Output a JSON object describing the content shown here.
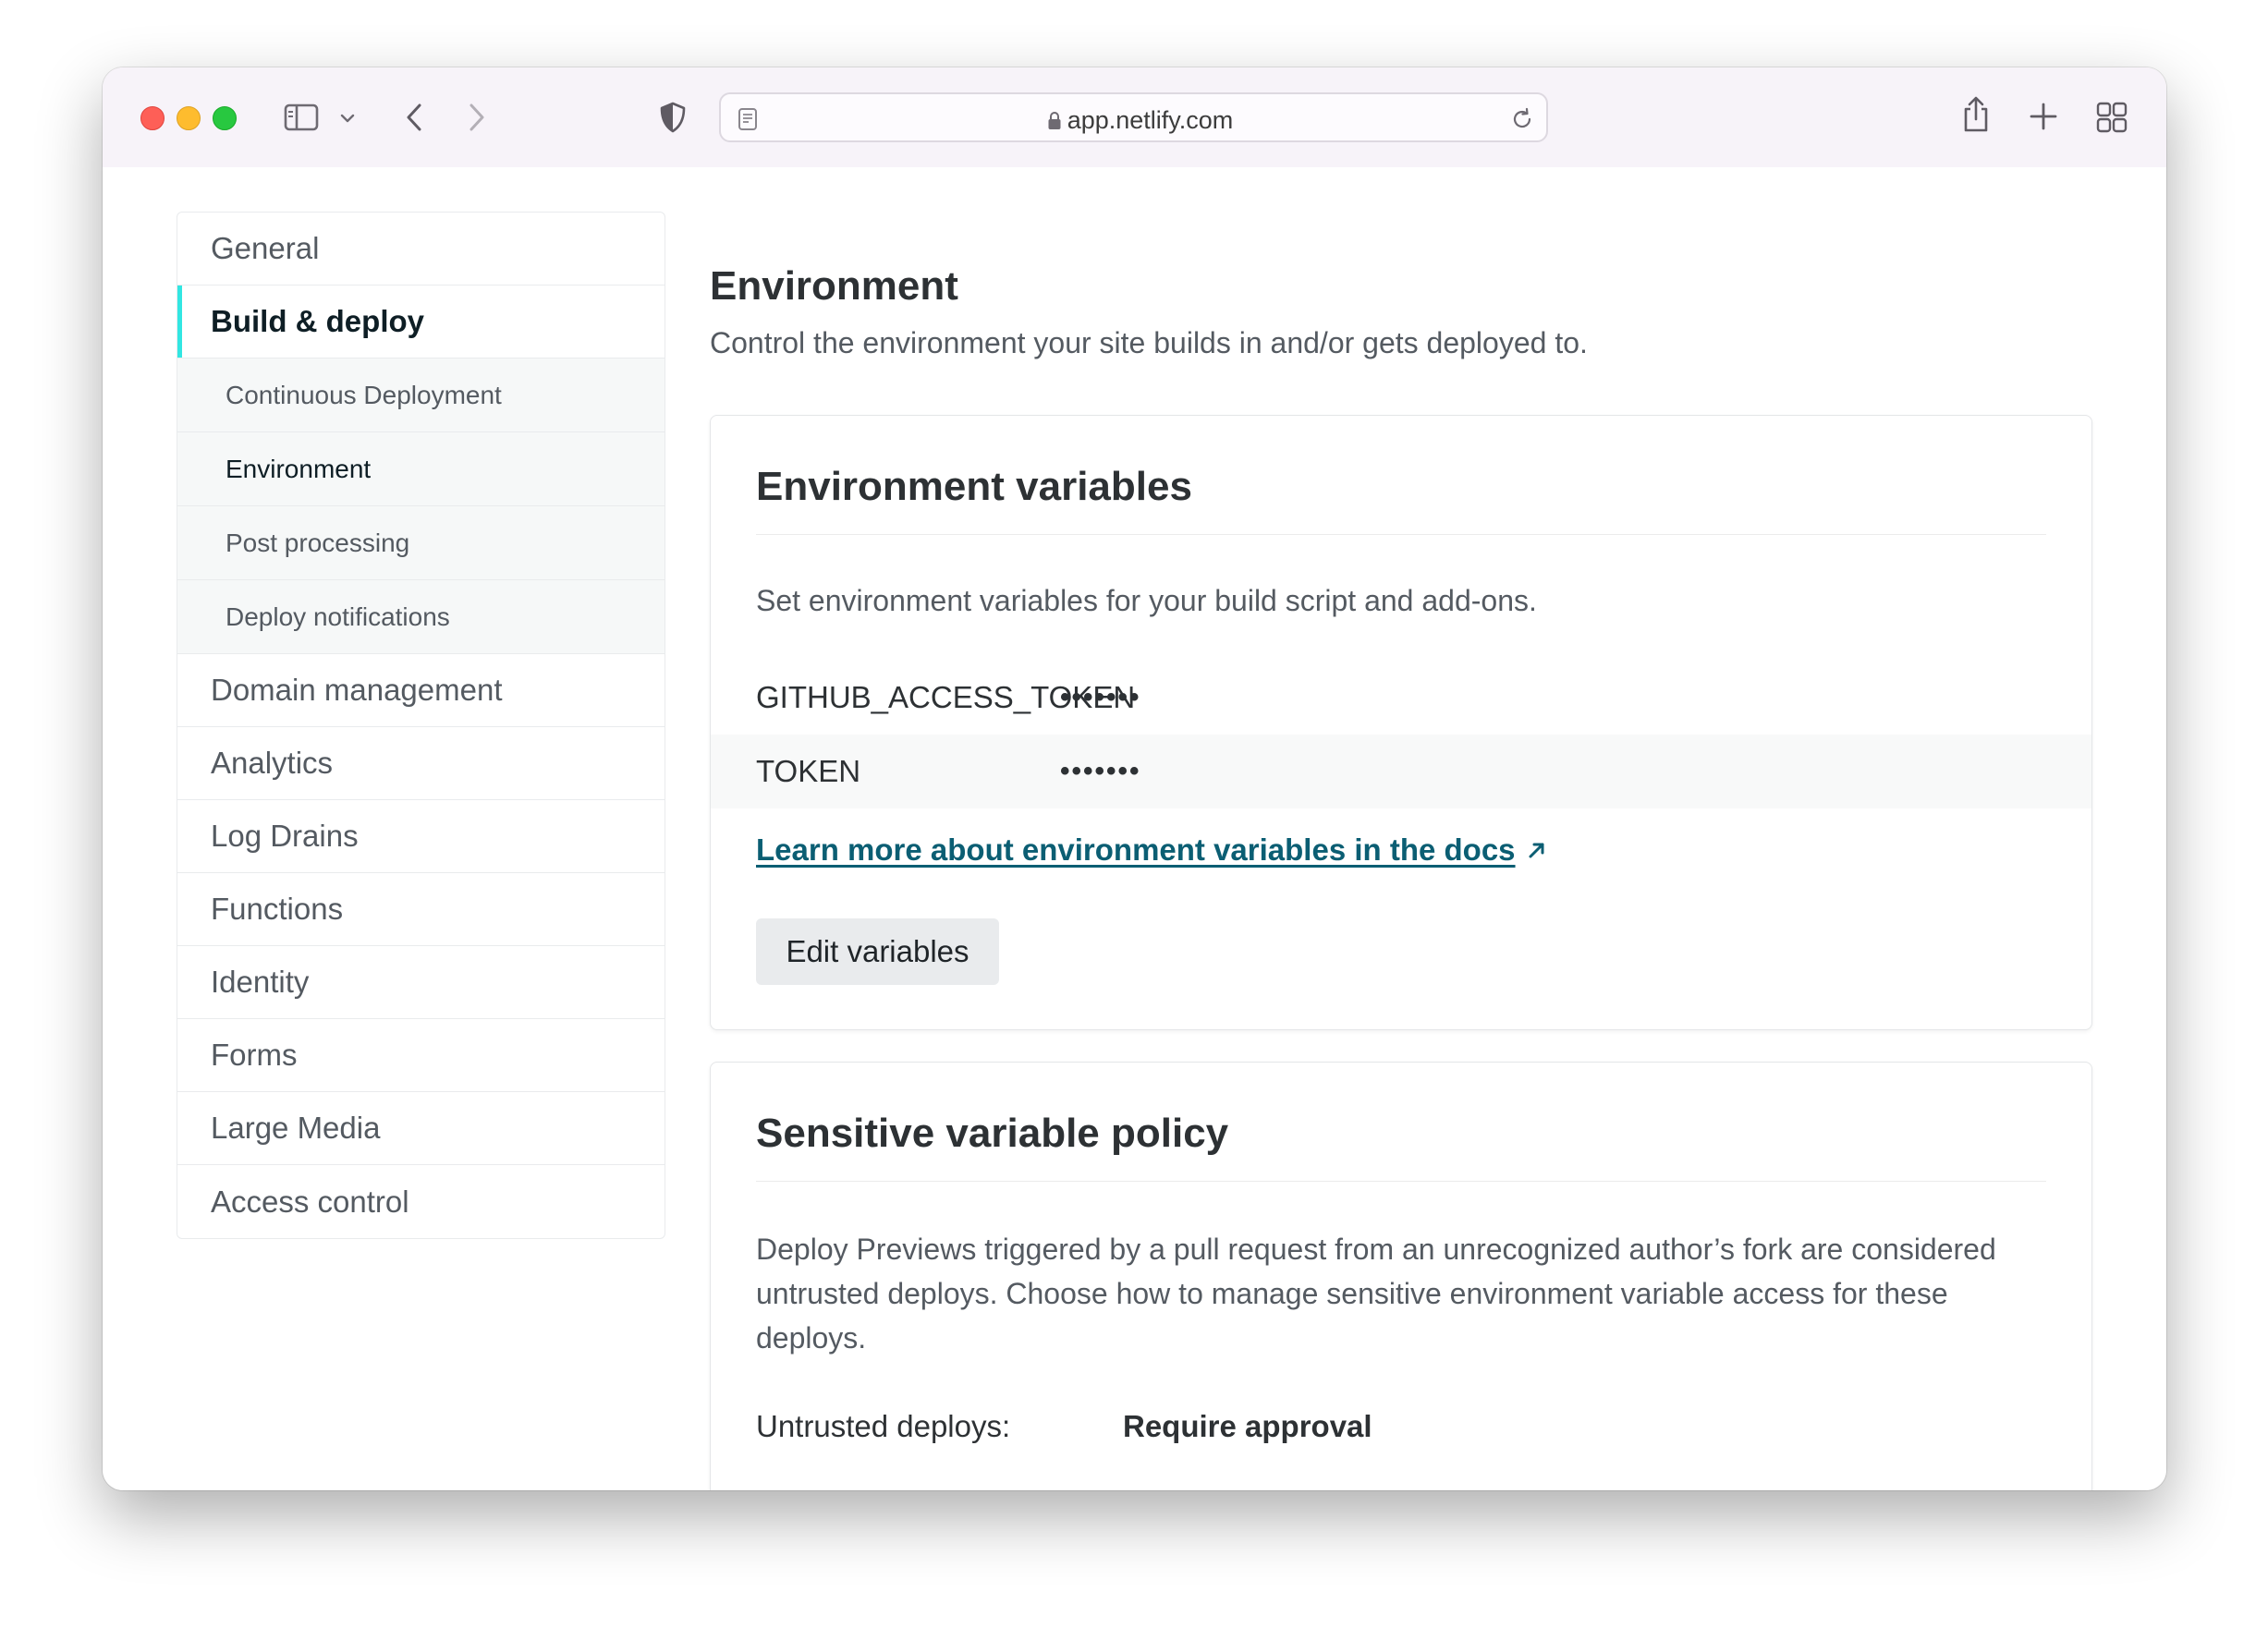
{
  "browser": {
    "url": "app.netlify.com"
  },
  "sidebar": {
    "items": [
      {
        "label": "General"
      },
      {
        "label": "Build & deploy"
      },
      {
        "label": "Domain management"
      },
      {
        "label": "Analytics"
      },
      {
        "label": "Log Drains"
      },
      {
        "label": "Functions"
      },
      {
        "label": "Identity"
      },
      {
        "label": "Forms"
      },
      {
        "label": "Large Media"
      },
      {
        "label": "Access control"
      }
    ],
    "subitems": [
      {
        "label": "Continuous Deployment"
      },
      {
        "label": "Environment"
      },
      {
        "label": "Post processing"
      },
      {
        "label": "Deploy notifications"
      }
    ],
    "active_item": "Build & deploy",
    "current_subitem": "Environment"
  },
  "page": {
    "title": "Environment",
    "subtitle": "Control the environment your site builds in and/or gets deployed to."
  },
  "env_card": {
    "title": "Environment variables",
    "description": "Set environment variables for your build script and add-ons.",
    "variables": [
      {
        "key": "GITHUB_ACCESS_TOKEN",
        "value": "•••••••"
      },
      {
        "key": "TOKEN",
        "value": "•••••••"
      }
    ],
    "docs_link": "Learn more about environment variables in the docs",
    "edit_button": "Edit variables"
  },
  "policy_card": {
    "title": "Sensitive variable policy",
    "description": "Deploy Previews triggered by a pull request from an unrecognized author’s fork are considered untrusted deploys. Choose how to manage sensitive environment variable access for these deploys.",
    "label": "Untrusted deploys:",
    "value": "Require approval"
  },
  "colors": {
    "accent": "#32e6e2",
    "link": "#0b5e73"
  }
}
